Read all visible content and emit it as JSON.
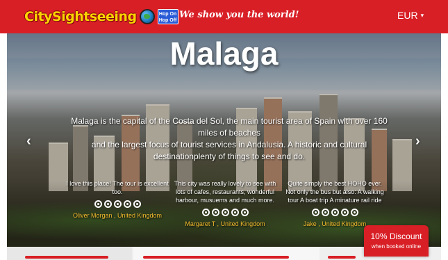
{
  "header": {
    "logo_text": "CitySightseeing",
    "logo_badge": [
      "Hop On",
      "Hop Off"
    ],
    "tagline": "We show you the world!",
    "currency": "EUR",
    "background_color": "#d81f26"
  },
  "hero": {
    "title": "Malaga",
    "description_lines": [
      "Malaga is the capital of the Costa del Sol, the main tourist area of Spain with over 160 miles of beaches",
      "and the largest focus of tourist services in Andalusia. A historic and cultural destinationplenty of things to see and do."
    ],
    "prev_icon": "chevron-left-icon",
    "next_icon": "chevron-right-icon"
  },
  "reviews": [
    {
      "text": "I love this place! The tour is excellent too.",
      "rating": 5,
      "author": "Oliver Morgan , United Kingdom"
    },
    {
      "text": "This city was really lovely to see with lots of cafes, restaurants, wonderful harbour, musuems and much more.",
      "rating": 5,
      "author": "Margaret T , United Kingdom"
    },
    {
      "text": "Quite simply the best HOHO ever. Not only the bus but also: A walking tour A boat trip A minature rail ride",
      "rating": 5,
      "author": "Jake , United Kingdom"
    }
  ],
  "discount": {
    "title": "10% Discount",
    "subtitle": "when booked online"
  },
  "colors": {
    "brand_red": "#d81f26",
    "logo_yellow": "#ffd400",
    "author_gold": "#f2b92d"
  }
}
